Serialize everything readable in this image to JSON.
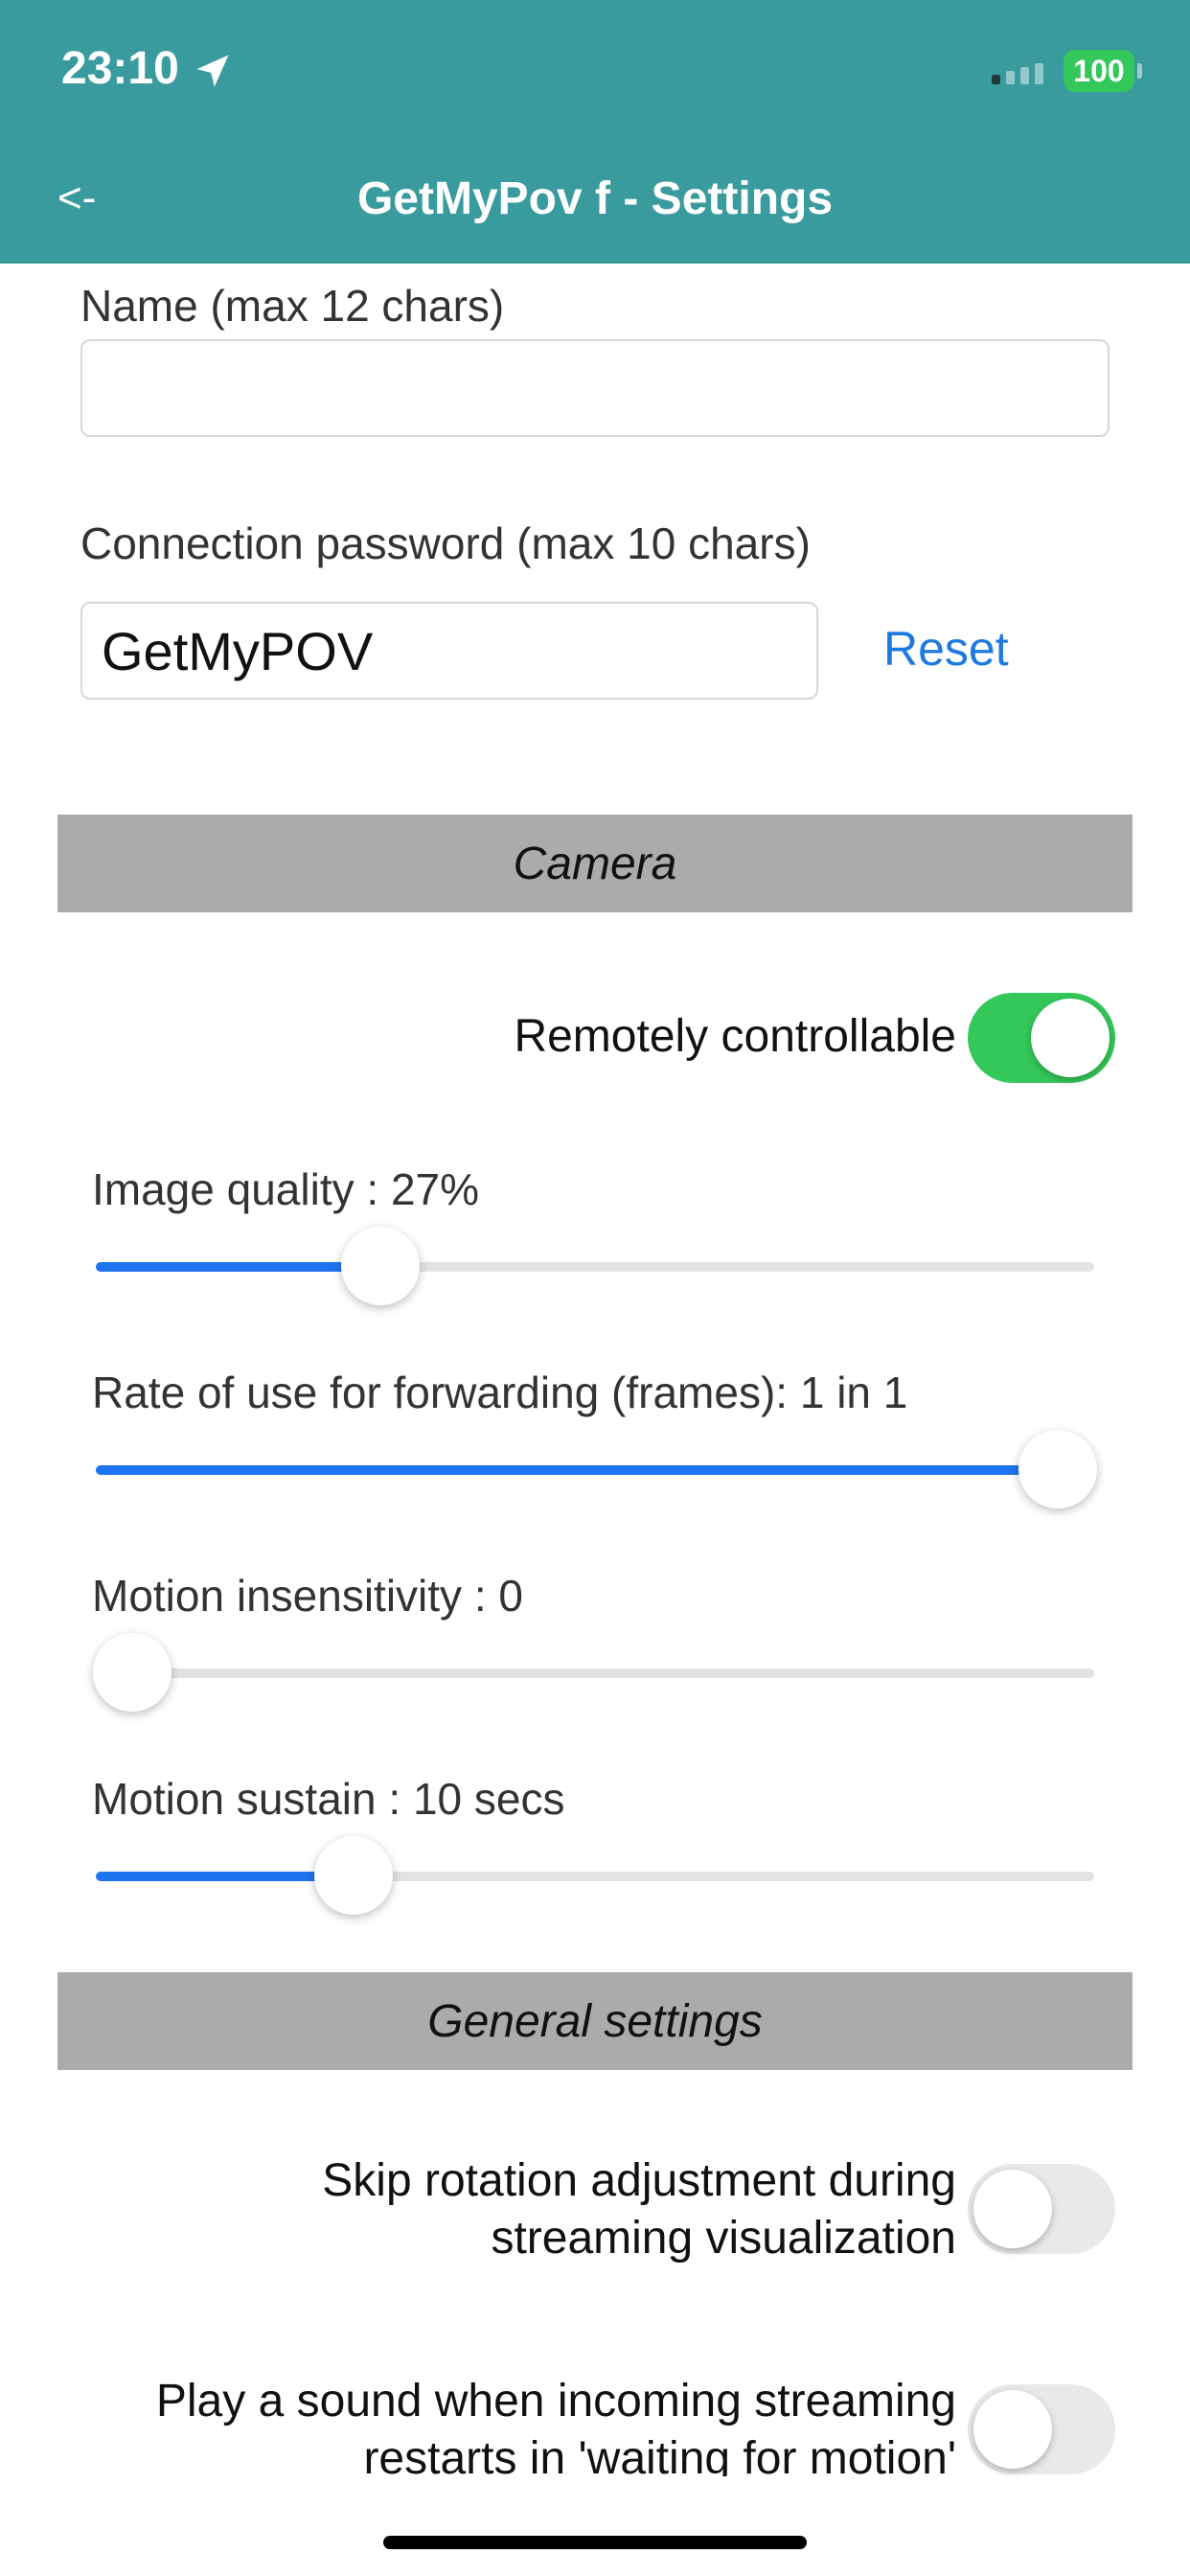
{
  "status_bar": {
    "time": "23:10",
    "battery": "100",
    "icons": [
      "location-arrow-icon",
      "signal-icon",
      "battery-icon"
    ]
  },
  "nav": {
    "back_label": "<-",
    "title": "GetMyPov f - Settings"
  },
  "form": {
    "name_label": "Name (max 12 chars)",
    "name_value": "",
    "password_label": "Connection password (max 10 chars)",
    "password_value": "GetMyPOV",
    "reset_label": "Reset"
  },
  "camera": {
    "section_title": "Camera",
    "remote_label": "Remotely controllable",
    "remote_on": true,
    "sliders": [
      {
        "label": "Image quality : 27%",
        "value": 0.285
      },
      {
        "label": "Rate of use for forwarding (frames): 1 in  1",
        "value": 0.964
      },
      {
        "label": "Motion insensitivity : 0",
        "value": 0.036
      },
      {
        "label": "Motion sustain : 10 secs",
        "value": 0.258
      }
    ]
  },
  "general": {
    "section_title": "General settings",
    "skip_rotation_line1": "Skip rotation adjustment during",
    "skip_rotation_line2": "streaming visualization",
    "skip_rotation_on": false,
    "play_sound_line1": "Play a sound when incoming streaming",
    "play_sound_line2": "restarts in 'waiting for motion'",
    "play_sound_on": false
  },
  "colors": {
    "header": "#3a9b9e",
    "toggle_on": "#34c759",
    "slider_fill": "#1e74f0",
    "link": "#1f7ae0",
    "section_bg": "#ababab"
  }
}
